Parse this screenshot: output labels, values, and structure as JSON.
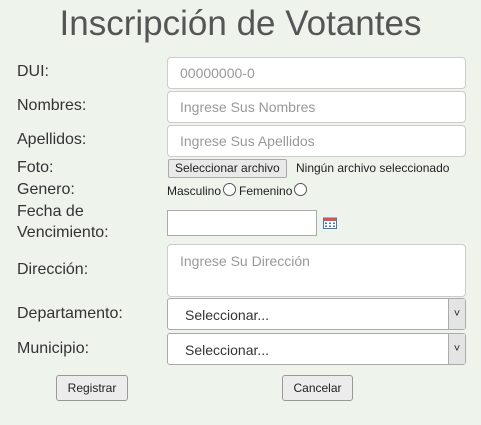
{
  "title": "Inscripción de Votantes",
  "fields": {
    "dui": {
      "label": "DUI:",
      "placeholder": "00000000-0"
    },
    "nombres": {
      "label": "Nombres:",
      "placeholder": "Ingrese Sus Nombres"
    },
    "apellidos": {
      "label": "Apellidos:",
      "placeholder": "Ingrese Sus Apellidos"
    },
    "foto": {
      "label": "Foto:",
      "button": "Seleccionar archivo",
      "status": "Ningún archivo seleccionado"
    },
    "genero": {
      "label": "Genero:",
      "options": [
        "Masculino",
        "Femenino"
      ]
    },
    "fecha": {
      "label_line1": "Fecha de",
      "label_line2": "Vencimiento:",
      "icon": "calendar-icon"
    },
    "direccion": {
      "label": "Dirección:",
      "placeholder": "Ingrese Su Dirección"
    },
    "departamento": {
      "label": "Departamento:",
      "selected": "Seleccionar..."
    },
    "municipio": {
      "label": "Municipio:",
      "selected": "Seleccionar..."
    }
  },
  "buttons": {
    "register": "Registrar",
    "cancel": "Cancelar"
  }
}
